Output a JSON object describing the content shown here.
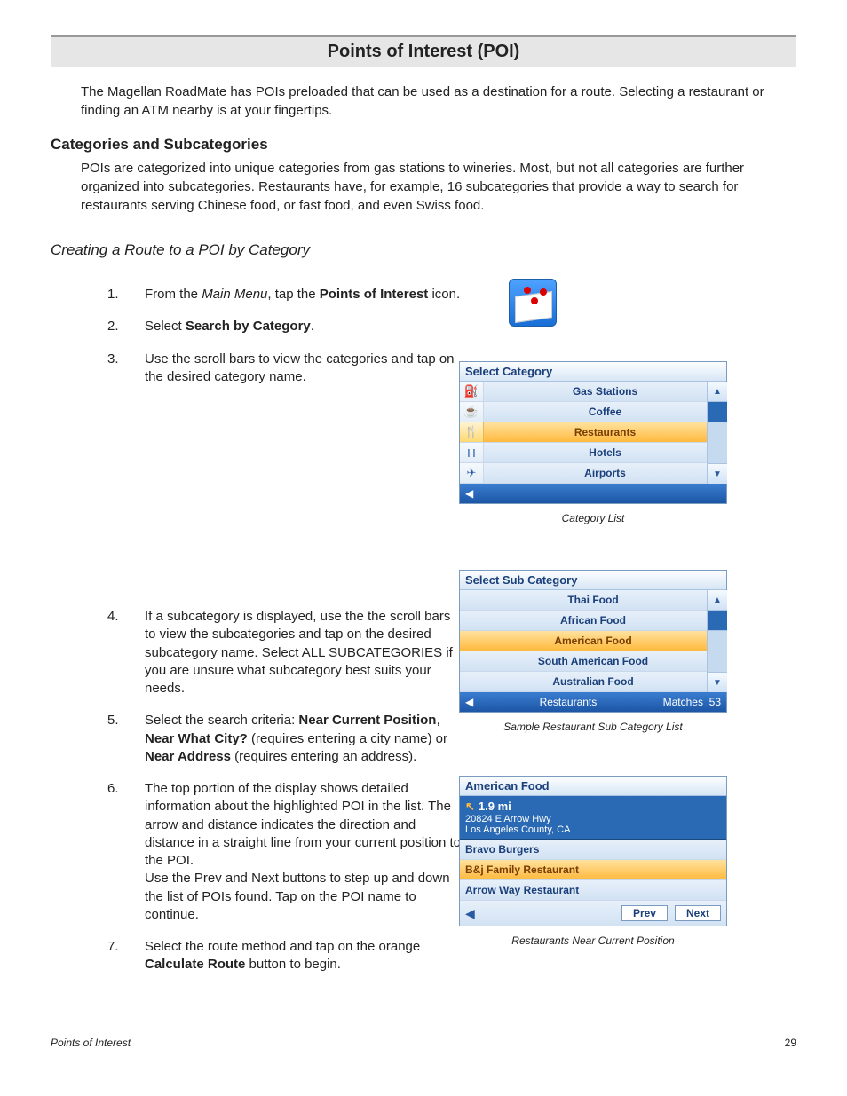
{
  "title": "Points of Interest (POI)",
  "intro": "The Magellan RoadMate has POIs preloaded that can be used as a destination for a route.  Selecting a restaurant or finding an ATM nearby is at your fingertips.",
  "section_heading": "Categories and Subcategories",
  "section_text": "POIs are categorized into unique categories from gas stations to wineries.  Most, but not all categories are further organized into subcategories.  Restaurants have, for example, 16 subcategories that provide a way to search for restaurants serving Chinese food, or fast food, and even Swiss food.",
  "subheading": "Creating a Route to a POI by Category",
  "steps": {
    "s1_a": "From the ",
    "s1_b": "Main Menu",
    "s1_c": ", tap the ",
    "s1_d": "Points of Interest",
    "s1_e": " icon.",
    "s2_a": "Select ",
    "s2_b": "Search by Category",
    "s2_c": ".",
    "s3": "Use the scroll bars to view the categories and tap on the desired category name.",
    "s4": "If a subcategory is displayed, use the the scroll bars to view the subcategories and tap on the desired subcategory name.  Select ALL SUBCATEGORIES if you are unsure what subcategory best suits your needs.",
    "s5_a": "Select the search criteria: ",
    "s5_b": "Near Current Position",
    "s5_c": ", ",
    "s5_d": "Near What City?",
    "s5_e": " (requires entering a city name) or ",
    "s5_f": "Near Address",
    "s5_g": " (requires entering an address).",
    "s6": "The top portion of the display shows detailed information about the highlighted POI in the list.  The arrow and distance indicates the direction and distance in a straight line from your current position to the POI.\nUse the Prev and Next buttons to step up and down the list of POIs found.  Tap on the POI name to continue.",
    "s7_a": "Select the route method and tap on the orange ",
    "s7_b": "Calculate Route",
    "s7_c": " button to begin."
  },
  "device1": {
    "title": "Select Category",
    "items": [
      "Gas Stations",
      "Coffee",
      "Restaurants",
      "Hotels",
      "Airports"
    ],
    "icons": [
      "⛽",
      "☕",
      "🍴",
      "H",
      "✈"
    ],
    "selected": 2,
    "caption": "Category List"
  },
  "device2": {
    "title": "Select Sub Category",
    "items": [
      "Thai Food",
      "African Food",
      "American Food",
      "South American Food",
      "Australian Food"
    ],
    "selected": 2,
    "footer_label": "Restaurants",
    "footer_matches_label": "Matches",
    "footer_matches_value": "53",
    "caption": "Sample  Restaurant Sub Category List"
  },
  "device3": {
    "title": "American Food",
    "distance": "1.9 mi",
    "addr1": "20824 E Arrow Hwy",
    "addr2": "Los Angeles County, CA",
    "items": [
      "Bravo Burgers",
      "B&j Family Restaurant",
      "Arrow Way Restaurant"
    ],
    "selected": 1,
    "prev": "Prev",
    "next": "Next",
    "caption": "Restaurants Near Current Position"
  },
  "footer": {
    "left": "Points of Interest",
    "right": "29"
  }
}
